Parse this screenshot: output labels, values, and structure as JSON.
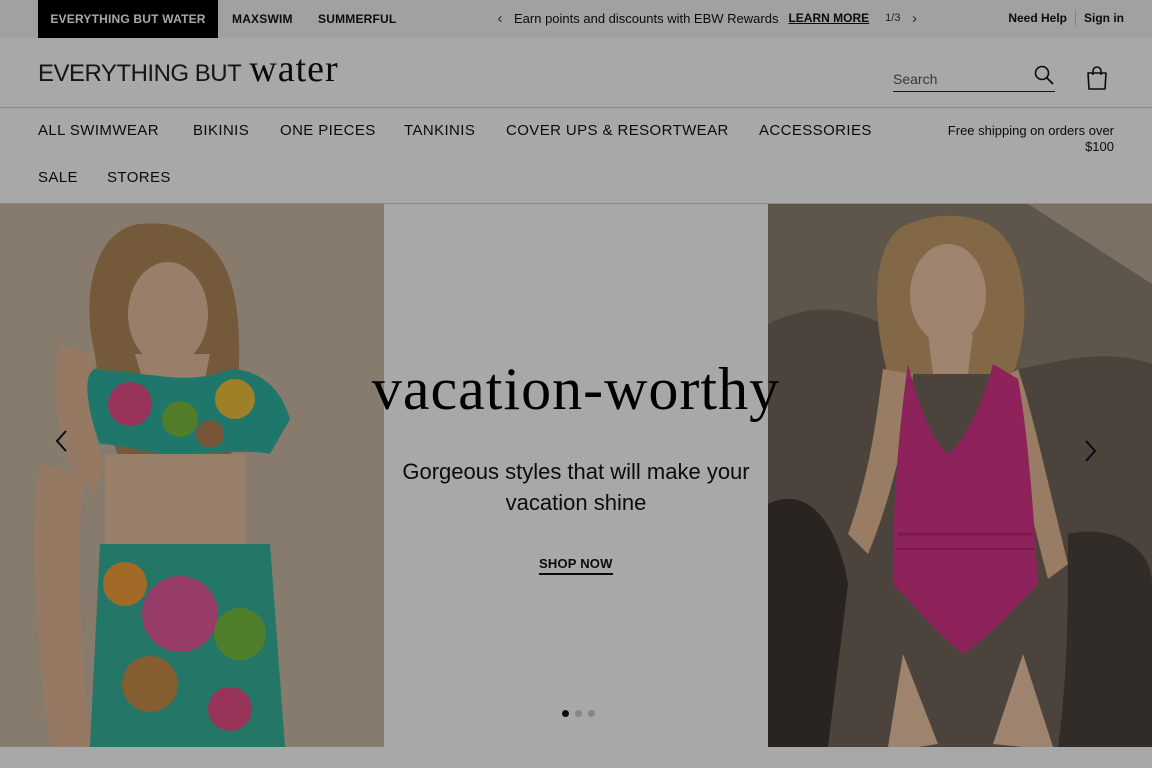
{
  "topbar": {
    "brands": [
      "EVERYTHING BUT WATER",
      "MAXSWIM",
      "SUMMERFUL"
    ],
    "promo_text": "Earn points and discounts with EBW Rewards",
    "promo_link": "LEARN MORE",
    "promo_count": "1/3",
    "need_help": "Need Help",
    "sign_in": "Sign in"
  },
  "header": {
    "logo_part1": "EVERYTHING BUT",
    "logo_part2": "water",
    "search_placeholder": "Search"
  },
  "nav": {
    "items": [
      "ALL SWIMWEAR",
      "BIKINIS",
      "ONE PIECES",
      "TANKINIS",
      "COVER UPS & RESORTWEAR",
      "ACCESSORIES",
      "SALE",
      "STORES"
    ],
    "shipping_note": "Free shipping on orders over $100"
  },
  "hero": {
    "headline": "vacation-worthy",
    "subline": "Gorgeous styles that will make your vacation shine",
    "cta": "SHOP NOW",
    "slide_count": 3,
    "active_slide": 1
  },
  "icons": [
    "chevron-left-icon",
    "chevron-right-icon",
    "search-icon",
    "shopping-bag-icon"
  ],
  "colors": {
    "brand_tab_bg": "#000000",
    "swimsuit_pink": "#d8348a",
    "overlay": "rgba(0,0,0,0.34)"
  }
}
